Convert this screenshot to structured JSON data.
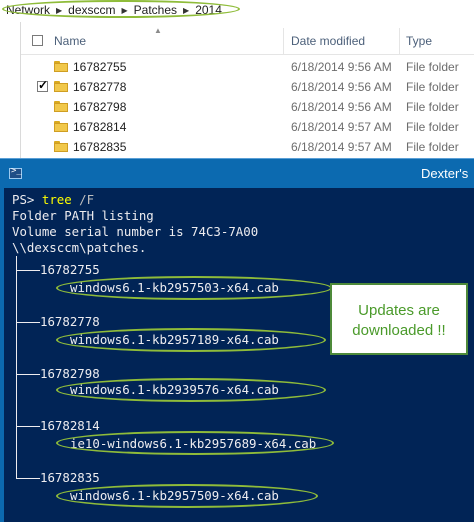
{
  "breadcrumb": [
    "Network",
    "dexsccm",
    "Patches",
    "2014"
  ],
  "columns": {
    "name": "Name",
    "date": "Date modified",
    "type": "Type"
  },
  "files": [
    {
      "name": "16782755",
      "date": "6/18/2014 9:56 AM",
      "type": "File folder",
      "checked": false
    },
    {
      "name": "16782778",
      "date": "6/18/2014 9:56 AM",
      "type": "File folder",
      "checked": true
    },
    {
      "name": "16782798",
      "date": "6/18/2014 9:56 AM",
      "type": "File folder",
      "checked": false
    },
    {
      "name": "16782814",
      "date": "6/18/2014 9:57 AM",
      "type": "File folder",
      "checked": false
    },
    {
      "name": "16782835",
      "date": "6/18/2014 9:57 AM",
      "type": "File folder",
      "checked": false
    }
  ],
  "powershell": {
    "title": "Dexter's",
    "icon": "powershell-icon",
    "prompt": "PS>",
    "command": "tree",
    "argument": "/F",
    "output": [
      "Folder PATH listing",
      "Volume serial number is 74C3-7A00",
      "\\\\dexsccm\\patches."
    ],
    "tree": [
      {
        "folder": "16782755",
        "file": "windows6.1-kb2957503-x64.cab"
      },
      {
        "folder": "16782778",
        "file": "windows6.1-kb2957189-x64.cab"
      },
      {
        "folder": "16782798",
        "file": "windows6.1-kb2939576-x64.cab"
      },
      {
        "folder": "16782814",
        "file": "ie10-windows6.1-kb2957689-x64.cab"
      },
      {
        "folder": "16782835",
        "file": "windows6.1-kb2957509-x64.cab"
      }
    ]
  },
  "callout": {
    "line1": "Updates are",
    "line2": "downloaded !!"
  },
  "colors": {
    "console_bg": "#012456",
    "title_bar": "#0c6ab0",
    "highlight": "#8fbc3a",
    "callout_text": "#4a9a2a"
  }
}
